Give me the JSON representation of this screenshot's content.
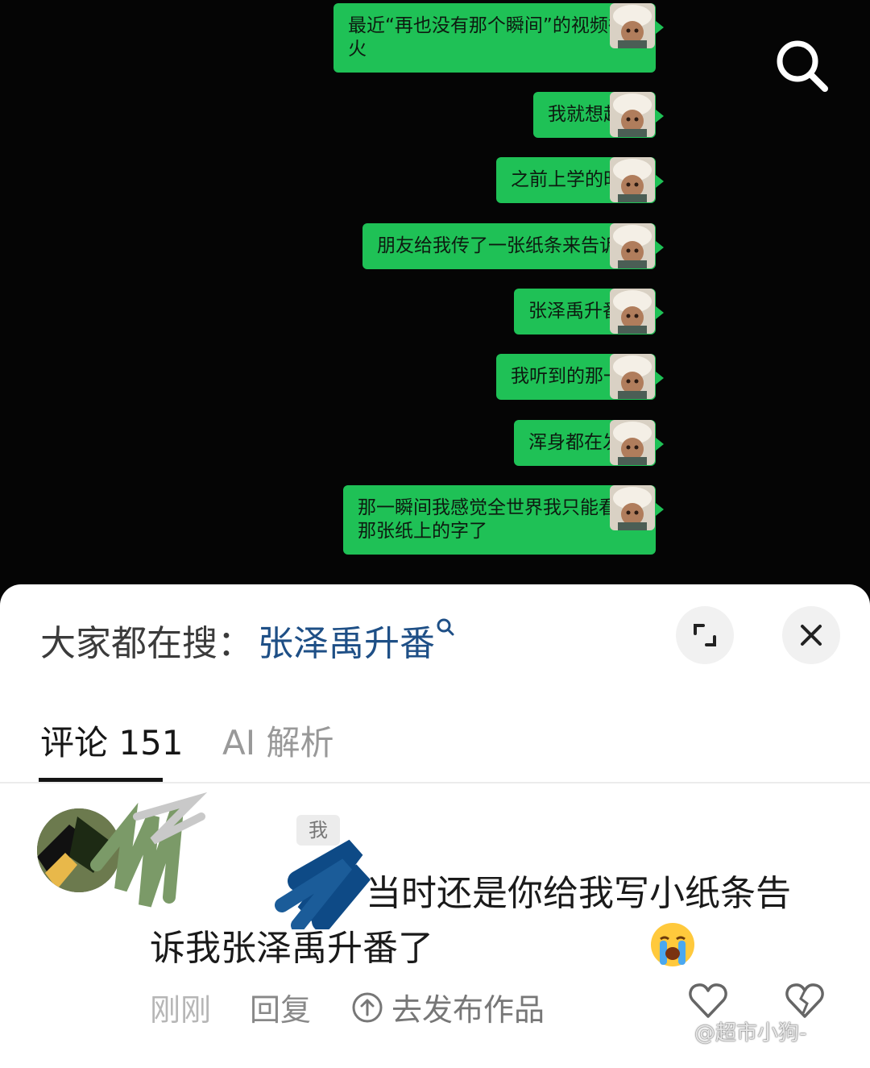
{
  "chat": {
    "messages": [
      {
        "text": "最近“再也没有那个瞬间”的视频很火"
      },
      {
        "text": "我就想起来"
      },
      {
        "text": "之前上学的时候"
      },
      {
        "text": "朋友给我传了一张纸条来告诉我"
      },
      {
        "text": "张泽禹升番了"
      },
      {
        "text": "我听到的那一刻"
      },
      {
        "text": "浑身都在发抖"
      },
      {
        "text": "那一瞬间我感觉全世界我只能看见那张纸上的字了"
      }
    ],
    "bubble_color": "#1fc156"
  },
  "sheet": {
    "trending_label": "大家都在搜：",
    "trending_term": "张泽禹升番",
    "tabs": {
      "comments": "评论 151",
      "ai": "AI 解析"
    },
    "comment": {
      "badge": "我",
      "text": "当时还是你给我写小纸条告诉我张泽禹升番了",
      "emoji": "loudly-crying-face-icon",
      "time": "刚刚",
      "reply": "回复",
      "publish": "去发布作品"
    }
  },
  "watermark": "@超市小狗-",
  "colors": {
    "accent_link": "#1e4f86",
    "background": "#050505"
  }
}
